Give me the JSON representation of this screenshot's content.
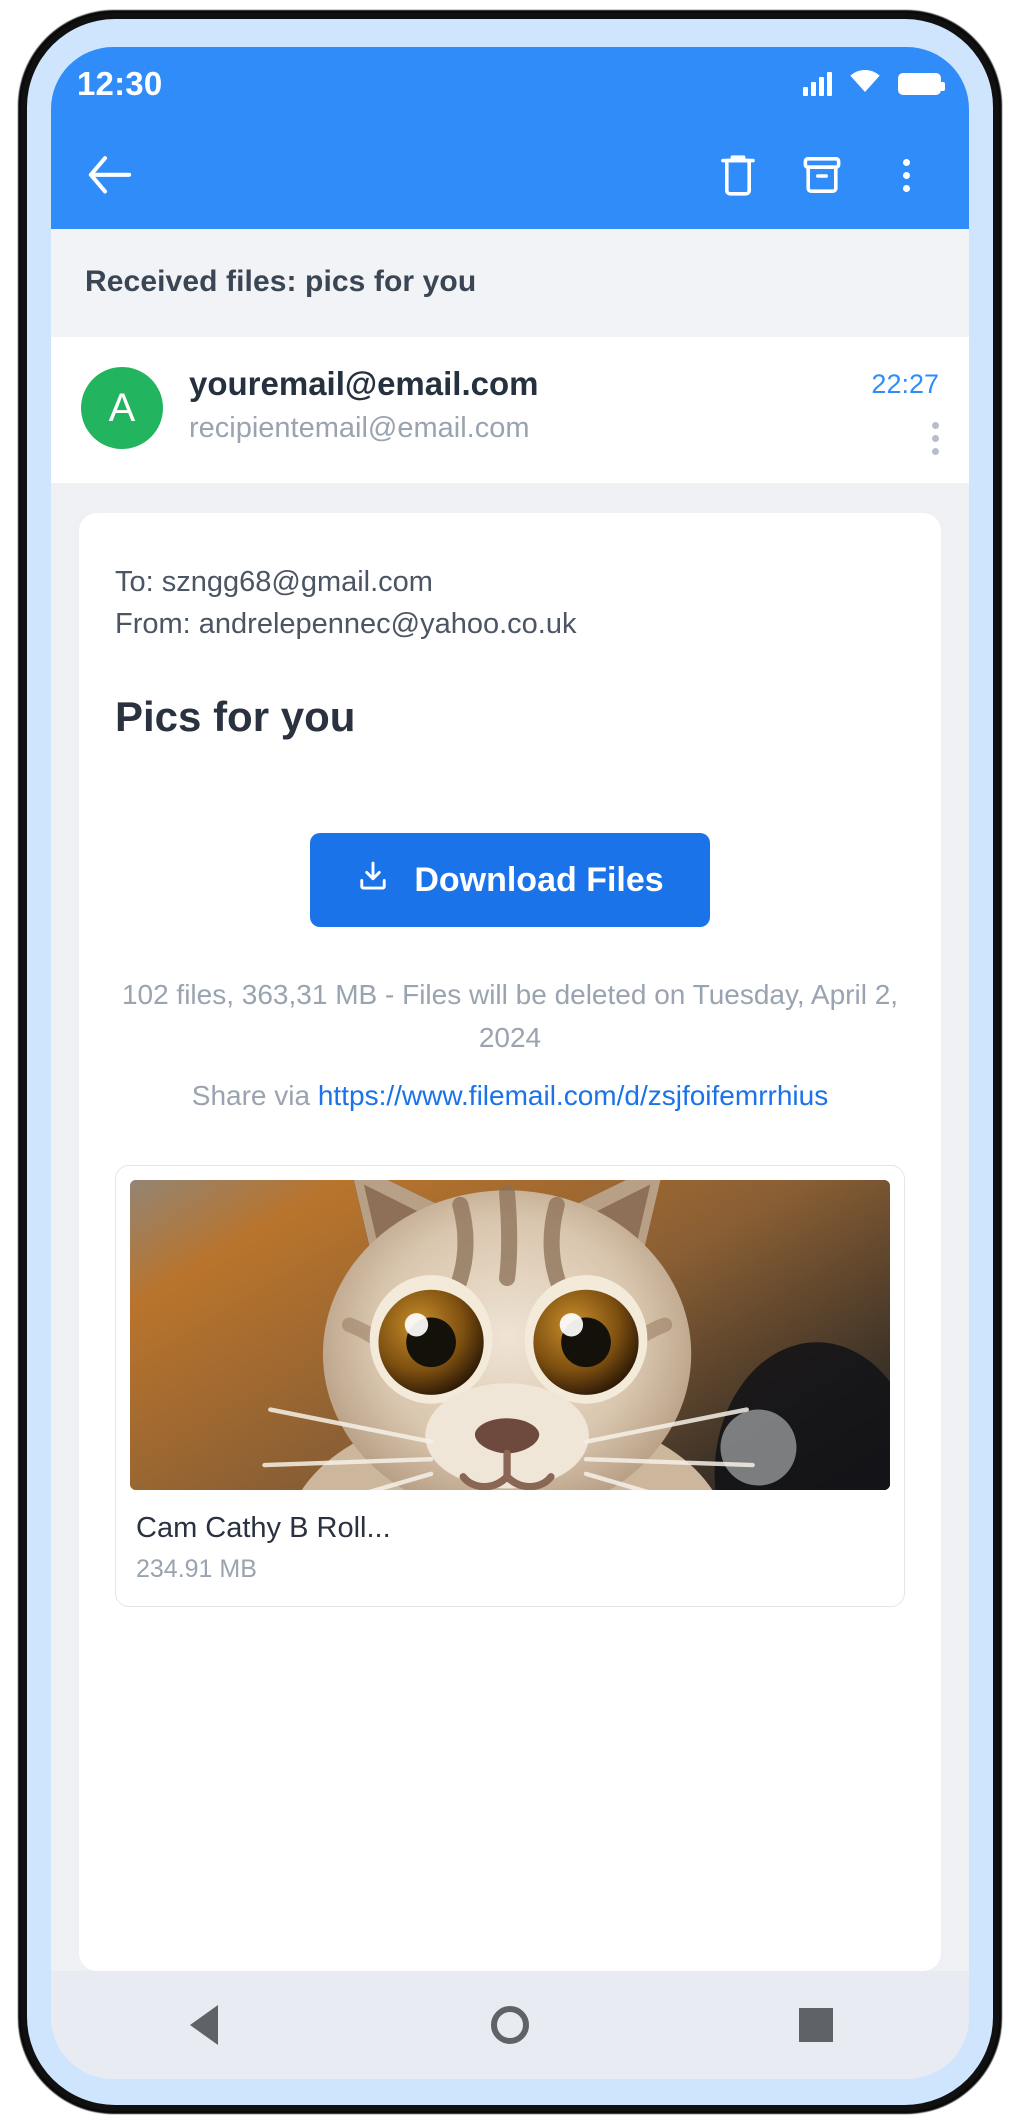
{
  "status_bar": {
    "time": "12:30",
    "icons": [
      "signal-icon",
      "wifi-icon",
      "battery-icon"
    ]
  },
  "toolbar": {
    "back_label": "back-arrow",
    "delete_label": "trash",
    "archive_label": "archive",
    "more_label": "more-options"
  },
  "subject": {
    "text": "Received files: pics for you"
  },
  "sender": {
    "avatar_initial": "A",
    "avatar_color": "#22b45f",
    "name": "youremail@email.com",
    "recipient": "recipientemail@email.com",
    "time": "22:27"
  },
  "mail": {
    "to_line": "To: szngg68@gmail.com",
    "from_line": "From: andrelepennec@yahoo.co.uk",
    "title": "Pics for you",
    "download_button": "Download Files",
    "files_info": "102 files, 363,31 MB - Files will be deleted on Tuesday, April 2, 2024",
    "share_prefix": "Share via ",
    "share_url": "https://www.filemail.com/d/zsjfoifemrrhius"
  },
  "attachment": {
    "name": "Cam Cathy B Roll...",
    "size": "234.91 MB",
    "thumbnail": "kitten-photo"
  },
  "nav_bar": {
    "back": "nav-back",
    "home": "nav-home",
    "recents": "nav-recents"
  },
  "colors": {
    "accent_blue": "#2f8cf8",
    "button_blue": "#1a73e8",
    "avatar_green": "#22b45f",
    "link_blue": "#1a73e8"
  }
}
